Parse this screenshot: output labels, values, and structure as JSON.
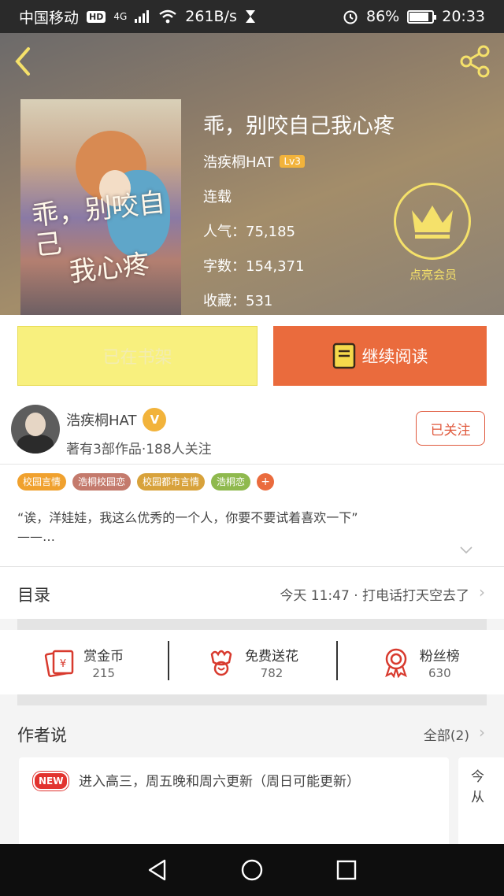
{
  "status_bar": {
    "carrier": "中国移动",
    "hd": "HD",
    "network": "4G",
    "speed": "261B/s",
    "battery": "86%",
    "battery_level": 0.86,
    "time": "20:33"
  },
  "book": {
    "title": "乖，别咬自己我心疼",
    "author": "浩疾桐HAT",
    "author_level": "Lv3",
    "status": "连载",
    "popularity": "人气：75,185",
    "word_count": "字数：154,371",
    "favorites": "收藏：531",
    "cover_title_line1": "乖，别咬自己",
    "cover_title_line2": "我心疼"
  },
  "vip": {
    "label": "点亮会员"
  },
  "actions": {
    "shelf_label": "已在书架",
    "read_label": "继续阅读"
  },
  "author": {
    "name": "浩疾桐HAT",
    "badge": "V",
    "stats": "著有3部作品·188人关注",
    "follow_label": "已关注"
  },
  "tags": [
    {
      "label": "校园言情",
      "color": "#f0a12e"
    },
    {
      "label": "浩桐校园恋",
      "color": "#c47a6c"
    },
    {
      "label": "校园都市言情",
      "color": "#d8a23b"
    },
    {
      "label": "浩桐恋",
      "color": "#8fb94e"
    },
    {
      "label": "+",
      "color": "#ea6b3d"
    }
  ],
  "intro": {
    "line1": "“诶，洋娃娃，我这么优秀的一个人，你要不要试着喜欢一下”",
    "line2": "——…"
  },
  "catalog": {
    "title": "目录",
    "latest": "今天 11:47 · 打电话打天空去了"
  },
  "stats": [
    {
      "label": "赏金币",
      "value": "215",
      "icon": "red-envelope-icon"
    },
    {
      "label": "免费送花",
      "value": "782",
      "icon": "flower-icon"
    },
    {
      "label": "粉丝榜",
      "value": "630",
      "icon": "medal-icon"
    }
  ],
  "author_says": {
    "title": "作者说",
    "all_label": "全部(2)",
    "new_badge": "NEW",
    "post": "进入高三，周五晚和周六更新（周日可能更新）",
    "peek_line1": "今",
    "peek_line2": "从"
  },
  "colors": {
    "accent": "#ea6b3d",
    "shelf_yellow": "#f8f07e",
    "gold": "#f5e16a"
  }
}
